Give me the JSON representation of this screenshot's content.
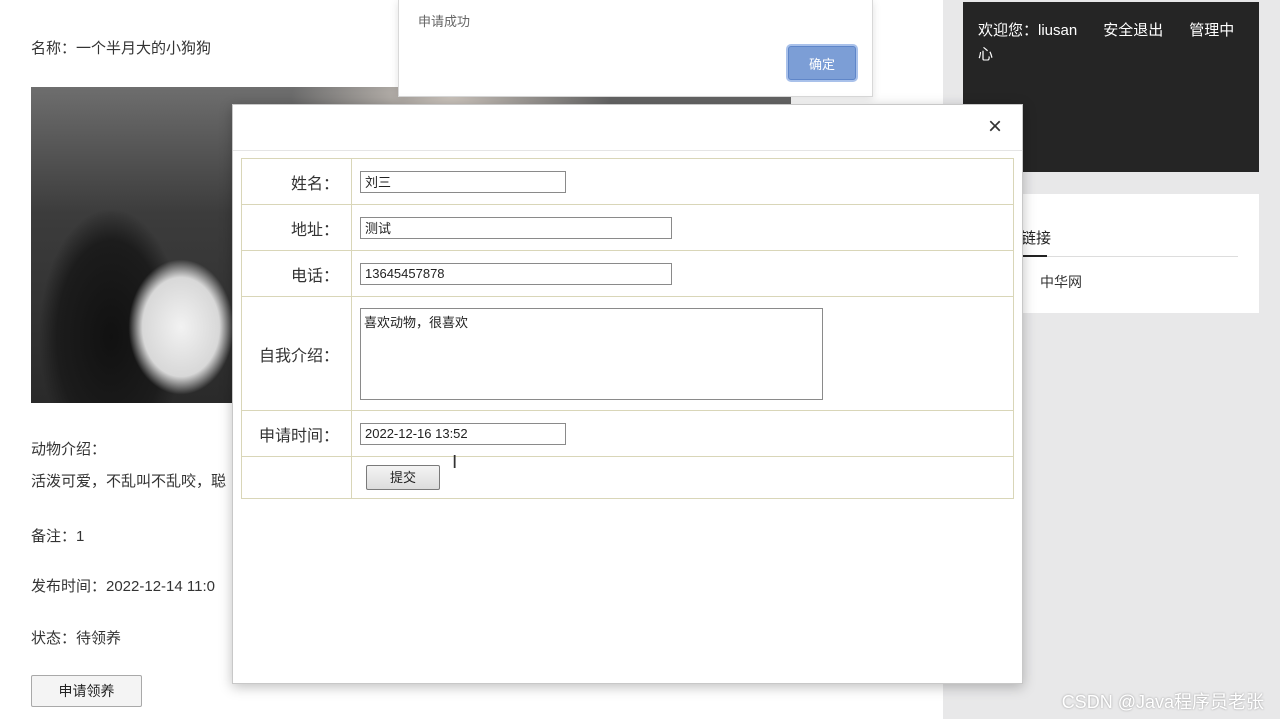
{
  "pet": {
    "name_line": "名称：一个半月大的小狗狗",
    "intro_label": "动物介绍：",
    "intro_text": "活泼可爱，不乱叫不乱咬，聪",
    "remark": "备注：1",
    "publish_time": "发布时间：2022-12-14 11:0",
    "status": "状态：待领养",
    "apply_button": "申请领养"
  },
  "user_box": {
    "welcome": "欢迎您：liusan",
    "logout": "安全退出",
    "admin": "管理中心"
  },
  "links": {
    "title": "链接",
    "item": "中华网"
  },
  "alert": {
    "message": "申请成功",
    "ok_button": "确定"
  },
  "form": {
    "close_glyph": "×",
    "name_label": "姓名：",
    "name_value": "刘三",
    "address_label": "地址：",
    "address_value": "测试",
    "phone_label": "电话：",
    "phone_value": "13645457878",
    "intro_label": "自我介绍：",
    "intro_value": "喜欢动物，很喜欢",
    "time_label": "申请时间：",
    "time_value": "2022-12-16 13:52",
    "submit_button": "提交"
  },
  "watermark": "CSDN @Java程序员老张"
}
